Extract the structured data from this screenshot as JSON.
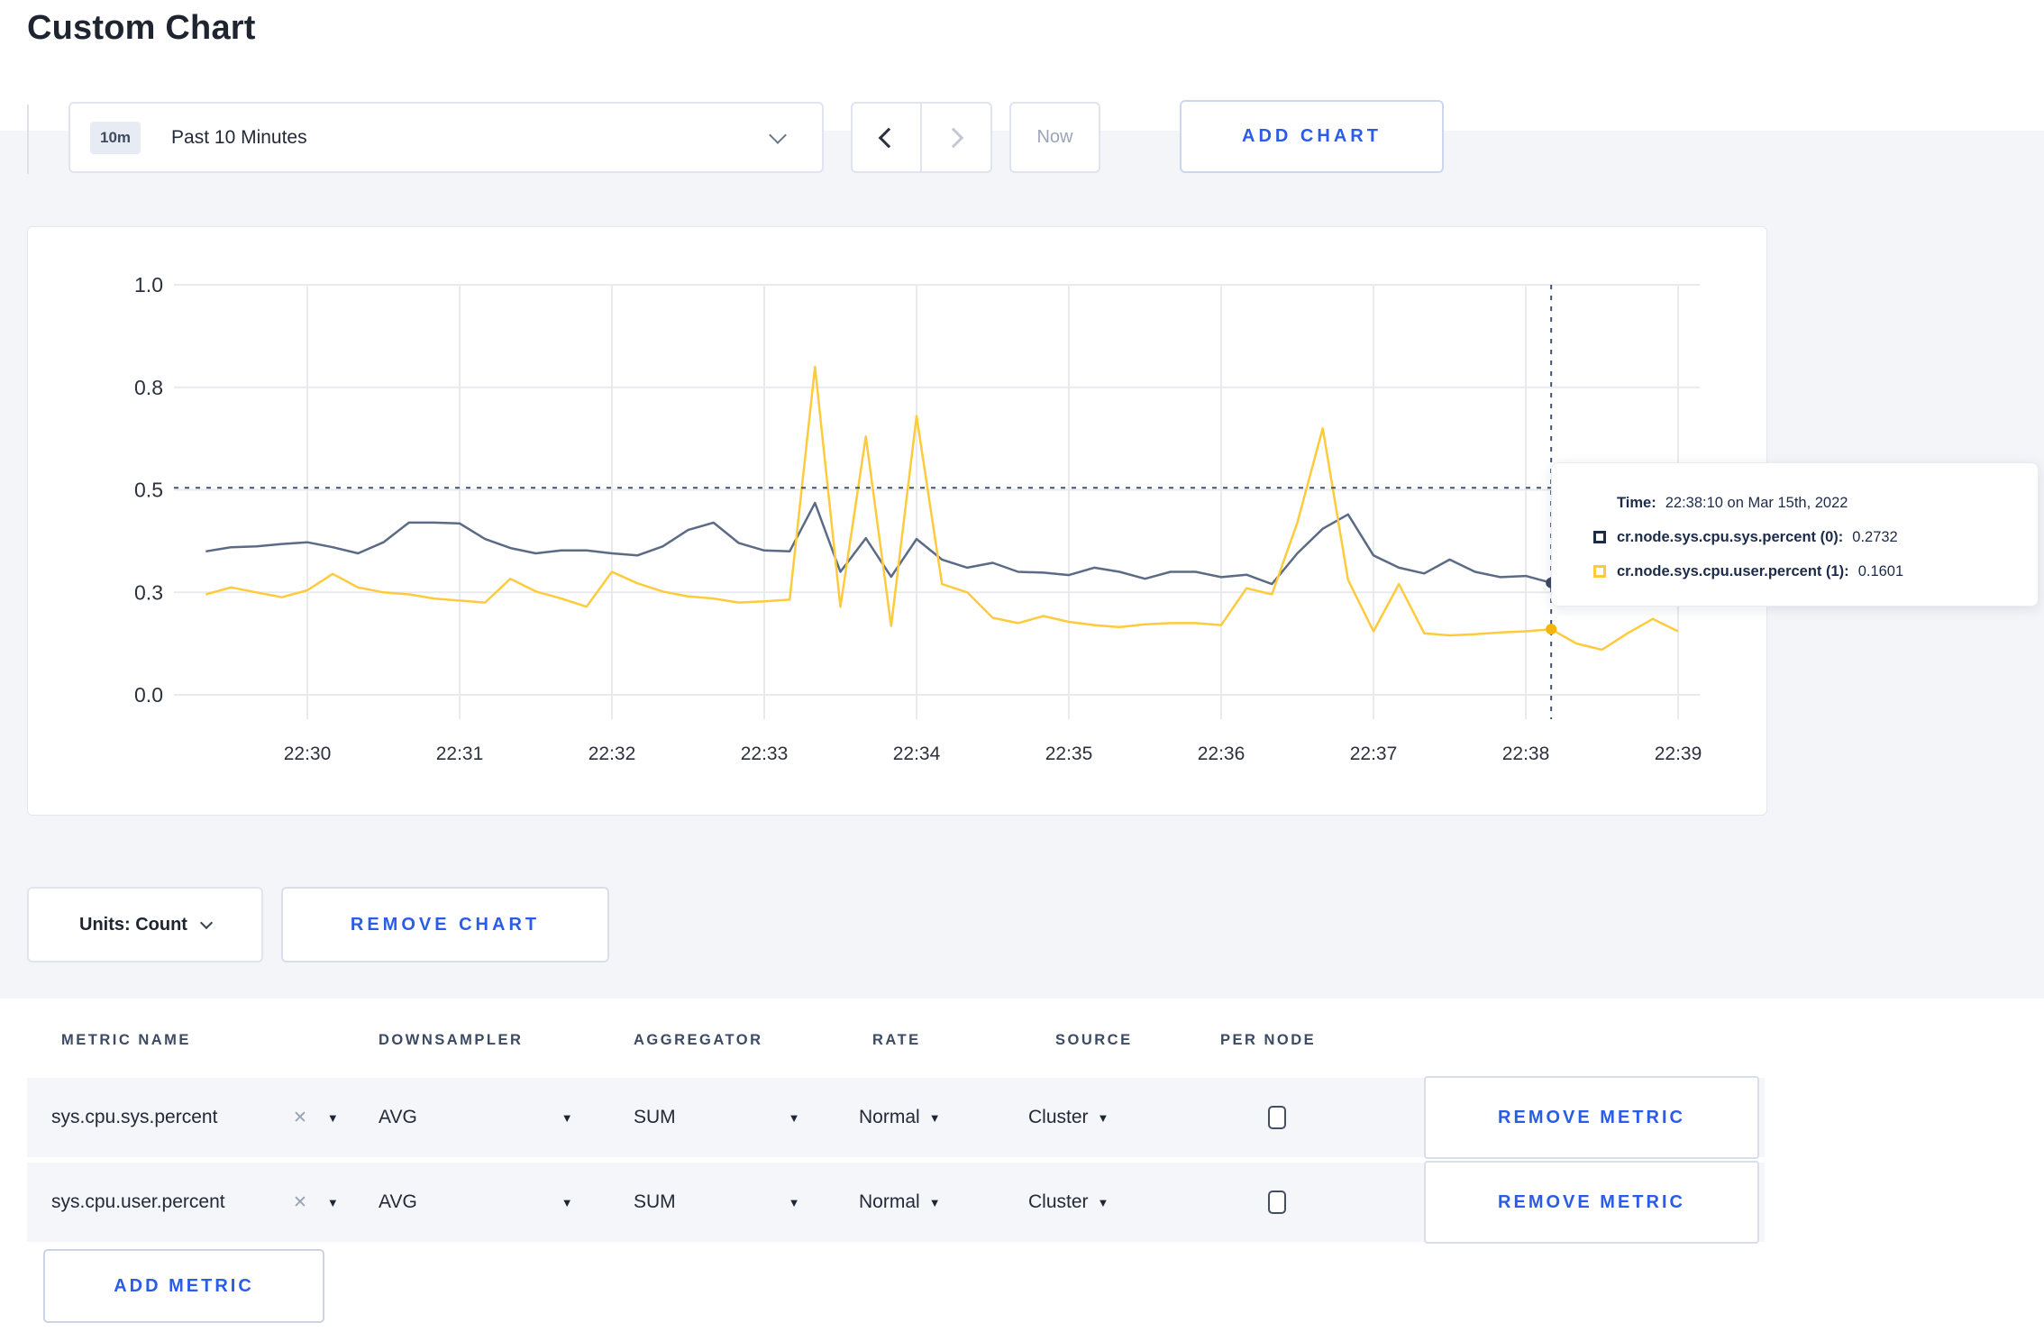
{
  "page": {
    "title": "Custom Chart"
  },
  "toolbar": {
    "range_badge": "10m",
    "range_label": "Past 10 Minutes",
    "now_label": "Now",
    "add_chart_label": "ADD CHART"
  },
  "chart_data": {
    "type": "line",
    "title": "",
    "xlabel": "",
    "ylabel": "",
    "ylim": [
      0,
      1
    ],
    "grid": true,
    "legend_position": "none",
    "x_ticks": [
      "22:30",
      "22:31",
      "22:32",
      "22:33",
      "22:34",
      "22:35",
      "22:36",
      "22:37",
      "22:38",
      "22:39"
    ],
    "y_tick_labels": [
      "0.0",
      "0.3",
      "0.5",
      "0.8",
      "1.0"
    ],
    "y_tick_values": [
      0,
      0.25,
      0.5,
      0.75,
      1.0
    ],
    "start_time": "22:29:20",
    "interval_seconds": 10,
    "series": [
      {
        "name": "cr.node.sys.cpu.sys.percent (0)",
        "color": "#5b6b86",
        "values": [
          0.35,
          0.36,
          0.362,
          0.368,
          0.372,
          0.36,
          0.345,
          0.372,
          0.42,
          0.42,
          0.418,
          0.38,
          0.358,
          0.345,
          0.352,
          0.352,
          0.345,
          0.34,
          0.362,
          0.402,
          0.42,
          0.37,
          0.352,
          0.35,
          0.468,
          0.3,
          0.382,
          0.288,
          0.38,
          0.33,
          0.31,
          0.322,
          0.3,
          0.298,
          0.292,
          0.31,
          0.3,
          0.283,
          0.3,
          0.3,
          0.287,
          0.293,
          0.27,
          0.345,
          0.405,
          0.44,
          0.34,
          0.31,
          0.296,
          0.33,
          0.3,
          0.287,
          0.29,
          0.2732,
          0.292,
          0.3,
          0.295,
          0.3,
          0.298
        ]
      },
      {
        "name": "cr.node.sys.cpu.user.percent (1)",
        "color": "#ffcb3d",
        "values": [
          0.245,
          0.262,
          0.25,
          0.238,
          0.255,
          0.295,
          0.262,
          0.25,
          0.245,
          0.235,
          0.23,
          0.225,
          0.283,
          0.252,
          0.235,
          0.215,
          0.3,
          0.272,
          0.252,
          0.24,
          0.235,
          0.225,
          0.228,
          0.232,
          0.8,
          0.215,
          0.63,
          0.168,
          0.68,
          0.27,
          0.25,
          0.188,
          0.175,
          0.192,
          0.178,
          0.17,
          0.165,
          0.172,
          0.175,
          0.175,
          0.17,
          0.26,
          0.245,
          0.42,
          0.65,
          0.28,
          0.155,
          0.27,
          0.15,
          0.145,
          0.148,
          0.152,
          0.155,
          0.1601,
          0.125,
          0.11,
          0.15,
          0.185,
          0.155
        ]
      }
    ],
    "crosshair": {
      "time": "22:38:10",
      "minutes_after_first_tick": 8.1667,
      "horizontal_value": 0.505,
      "hover_points": [
        0.2732,
        0.1601
      ]
    }
  },
  "tooltip": {
    "time_label": "Time:",
    "time_value": "22:38:10 on Mar 15th, 2022",
    "rows": [
      {
        "label": "cr.node.sys.cpu.sys.percent (0):",
        "value": "0.2732",
        "color": "#1c2b4a"
      },
      {
        "label": "cr.node.sys.cpu.user.percent (1):",
        "value": "0.1601",
        "color": "#ffcb3d"
      }
    ]
  },
  "chart_footer": {
    "units_label": "Units: Count",
    "remove_chart_label": "REMOVE CHART"
  },
  "metrics_table": {
    "headers": [
      "METRIC NAME",
      "DOWNSAMPLER",
      "AGGREGATOR",
      "RATE",
      "SOURCE",
      "PER NODE"
    ],
    "rows": [
      {
        "metric": "sys.cpu.sys.percent",
        "downsampler": "AVG",
        "aggregator": "SUM",
        "rate": "Normal",
        "source": "Cluster",
        "per_node_checked": false,
        "remove_label": "REMOVE METRIC"
      },
      {
        "metric": "sys.cpu.user.percent",
        "downsampler": "AVG",
        "aggregator": "SUM",
        "rate": "Normal",
        "source": "Cluster",
        "per_node_checked": false,
        "remove_label": "REMOVE METRIC"
      }
    ],
    "add_metric_label": "ADD METRIC"
  }
}
